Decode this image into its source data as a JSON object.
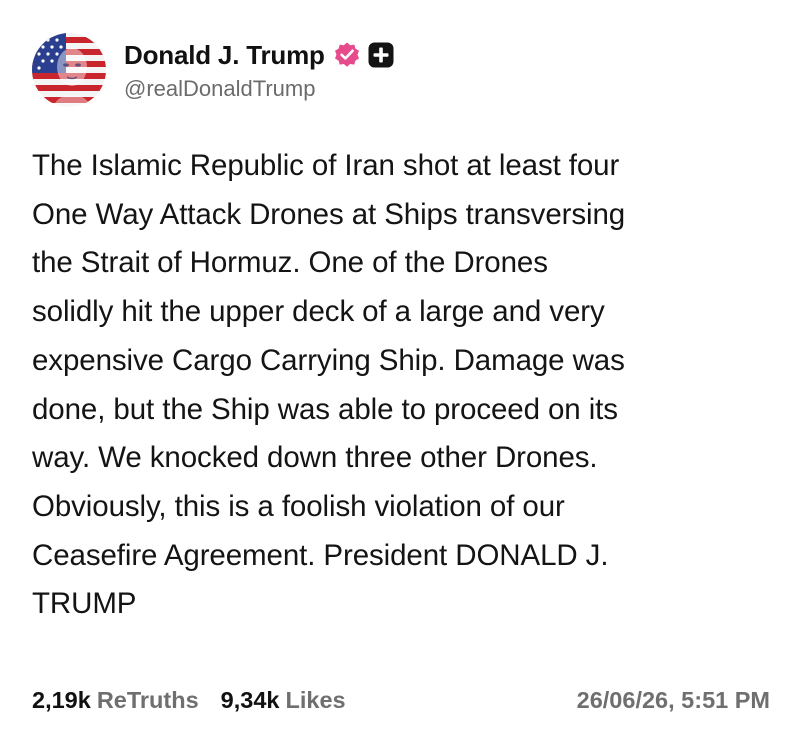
{
  "author": {
    "display_name": "Donald J. Trump",
    "handle": "@realDonaldTrump",
    "avatar_icon": "flag-portrait-avatar",
    "verified_icon": "verified-badge-icon",
    "plus_icon": "plus-badge-icon",
    "verified_color": "#e64b8d"
  },
  "post": {
    "text": "The Islamic Republic of Iran shot at least four\nOne Way Attack Drones at Ships transversing\nthe Strait of Hormuz. One of the Drones\nsolidly hit the upper deck of a large and very\nexpensive Cargo Carrying Ship. Damage was\ndone, but the Ship was able to proceed on its\nway. We knocked down three other Drones.\nObviously, this is a foolish violation of our\nCeasefire Agreement. President DONALD J.\nTRUMP"
  },
  "stats": {
    "retruths_count": "2,19k",
    "retruths_label": "ReTruths",
    "likes_count": "9,34k",
    "likes_label": "Likes",
    "timestamp": "26/06/26, 5:51 PM"
  }
}
